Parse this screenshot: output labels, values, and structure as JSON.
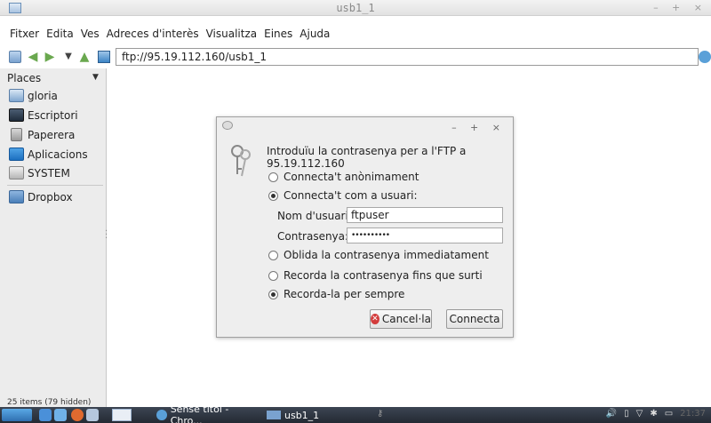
{
  "window": {
    "title": "usb1_1",
    "controls": "– + ×"
  },
  "menu": [
    "Fitxer",
    "Edita",
    "Ves",
    "Adreces d'interès",
    "Visualitza",
    "Eines",
    "Ajuda"
  ],
  "toolbar": {
    "address": "ftp://95.19.112.160/usb1_1"
  },
  "sidebar": {
    "header": "Places",
    "items": [
      "gloria",
      "Escriptori",
      "Paperera",
      "Aplicacions",
      "SYSTEM"
    ],
    "bookmarks": [
      "Dropbox"
    ]
  },
  "status": "25 items (79 hidden)",
  "dialog": {
    "controls": "– + ×",
    "message": "Introduïu la contrasenya per a l'FTP a 95.19.112.160",
    "opt_anonymous": "Connecta't anònimament",
    "opt_user": "Connecta't com a usuari:",
    "username_label": "Nom d'usuari:",
    "username_value": "ftpuser",
    "password_label": "Contrasenya:",
    "password_value": "••••••••••",
    "remember_none": "Oblida la contrasenya immediatament",
    "remember_session": "Recorda la contrasenya fins que surti",
    "remember_forever": "Recorda-la per sempre",
    "cancel_label": "Cancel·la",
    "connect_label": "Connecta"
  },
  "taskbar": {
    "task_browser": "Sense títol - Chro...",
    "task_fm": "usb1_1",
    "clock": "21:37"
  }
}
